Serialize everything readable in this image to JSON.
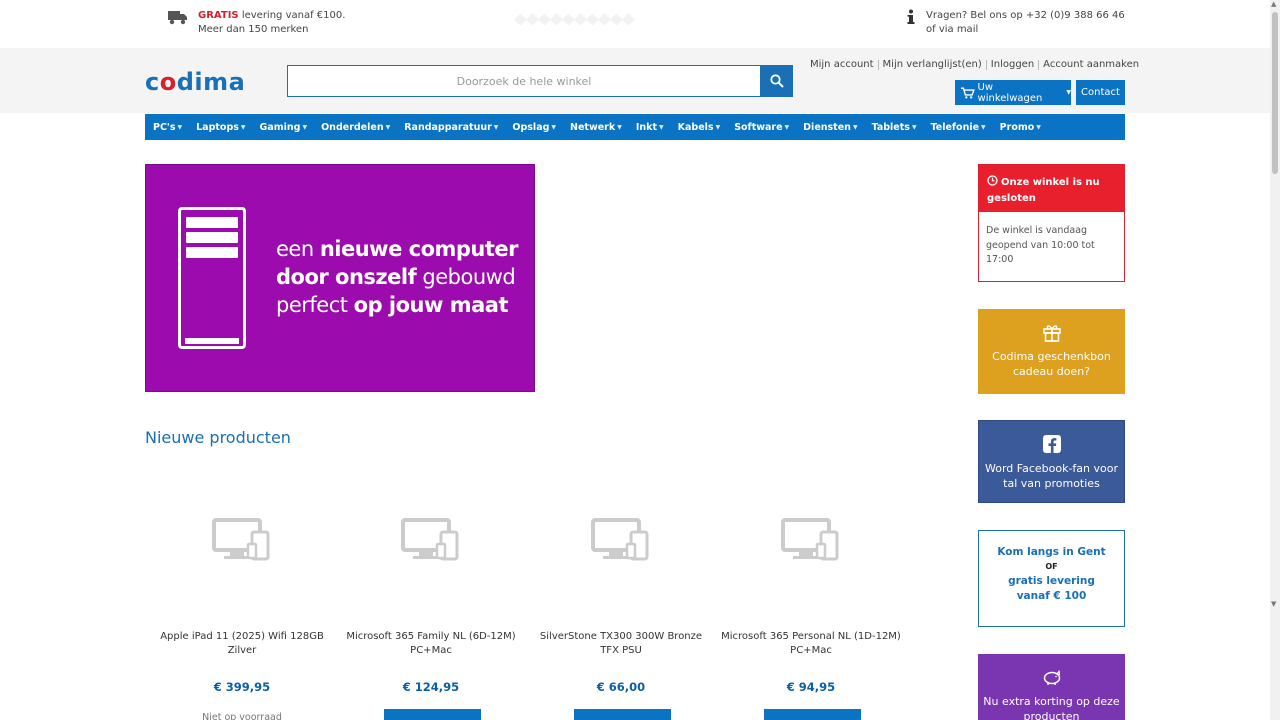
{
  "topbar": {
    "free_label": "GRATIS",
    "free_rest": "levering vanaf €100.",
    "brands": "Meer dan 150 merken",
    "questions_line1": "Vragen? Bel ons op +32 (0)9 388 66 46",
    "questions_line2": "of via mail"
  },
  "header": {
    "logo_co": "c",
    "logo_o": "o",
    "logo_rest": "dima",
    "search_placeholder": "Doorzoek de hele winkel",
    "account_links": [
      "Mijn account",
      "Mijn verlanglijst(en)",
      "Inloggen",
      "Account aanmaken"
    ],
    "cart_label": "Uw winkelwagen",
    "contact_label": "Contact"
  },
  "nav": {
    "items": [
      {
        "label": "PC's"
      },
      {
        "label": "Laptops"
      },
      {
        "label": "Gaming"
      },
      {
        "label": "Onderdelen"
      },
      {
        "label": "Randapparatuur"
      },
      {
        "label": "Opslag"
      },
      {
        "label": "Netwerk"
      },
      {
        "label": "Inkt"
      },
      {
        "label": "Kabels"
      },
      {
        "label": "Software"
      },
      {
        "label": "Diensten"
      },
      {
        "label": "Tablets"
      },
      {
        "label": "Telefonie"
      },
      {
        "label": "Promo"
      }
    ]
  },
  "banner": {
    "line1_light": "een ",
    "line1_bold": "nieuwe computer",
    "line2_bold": "door onszelf",
    "line2_light": " gebouwd",
    "line3_light": "perfect ",
    "line3_bold": "op jouw maat"
  },
  "main": {
    "section_title": "Nieuwe producten",
    "products": [
      {
        "name": "Apple iPad 11 (2025) Wifi 128GB Zilver",
        "price": "€ 399,95",
        "stock": "Niet op voorraad"
      },
      {
        "name": "Microsoft 365 Family NL (6D-12M) PC+Mac",
        "price": "€ 124,95"
      },
      {
        "name": "SilverStone TX300 300W Bronze TFX PSU",
        "price": "€ 66,00"
      },
      {
        "name": "Microsoft 365 Personal NL (1D-12M) PC+Mac",
        "price": "€ 94,95"
      }
    ]
  },
  "sidebar": {
    "closed_title": "Onze winkel is nu gesloten",
    "closed_body": "De winkel is vandaag geopend van 10:00 tot 17:00",
    "gift_text": "Codima geschenkbon cadeau doen?",
    "fb_text": "Word Facebook-fan voor tal van promoties",
    "visit_line1": "Kom langs in Gent",
    "visit_or": "OF",
    "visit_line2": "gratis levering vanaf € 100",
    "promo_text": "Nu extra korting op deze producten"
  },
  "colors": {
    "brand_blue": "#0b73c3",
    "brand_red": "#e8202e",
    "banner_purple": "#9c0bad",
    "gift_yellow": "#dda01f",
    "facebook_blue": "#3b5a9a",
    "promo_purple": "#7a35b0"
  },
  "icons": [
    "truck-icon",
    "info-icon",
    "search-icon",
    "cart-icon",
    "clock-icon",
    "gift-icon",
    "facebook-icon",
    "piggy-bank-icon",
    "device-placeholder-icon"
  ]
}
